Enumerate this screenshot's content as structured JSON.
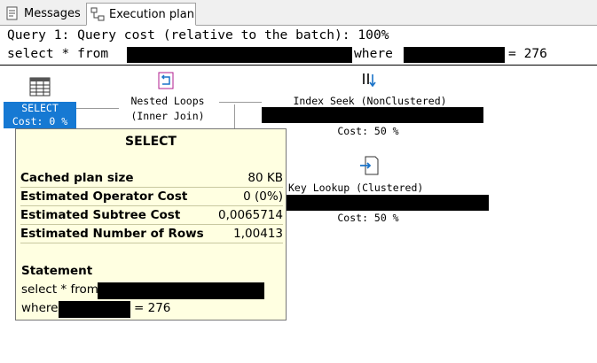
{
  "tabs": {
    "messages": "Messages",
    "plan": "Execution plan"
  },
  "query": {
    "header": "Query 1: Query cost (relative to the batch): 100%",
    "sql_select": "select * from",
    "sql_where": "where",
    "sql_value": "= 276"
  },
  "plan": {
    "select": {
      "name": "SELECT",
      "cost": "Cost: 0 %"
    },
    "nested_loops": {
      "name": "Nested Loops",
      "sub": "(Inner Join)"
    },
    "index_seek": {
      "name": "Index Seek (NonClustered)",
      "cost": "Cost: 50 %"
    },
    "key_lookup": {
      "name": "Key Lookup (Clustered)",
      "cost": "Cost: 50 %"
    }
  },
  "tooltip": {
    "title": "SELECT",
    "rows": [
      {
        "label": "Cached plan size",
        "value": "80 KB"
      },
      {
        "label": "Estimated Operator Cost",
        "value": "0 (0%)"
      },
      {
        "label": "Estimated Subtree Cost",
        "value": "0,0065714"
      },
      {
        "label": "Estimated Number of Rows",
        "value": "1,00413"
      }
    ],
    "statement_label": "Statement",
    "statement_select": "select * from",
    "statement_where": "where",
    "statement_value": "= 276"
  },
  "icons": [
    "messages-icon",
    "execution-plan-icon",
    "select-operator-icon",
    "nested-loops-icon",
    "index-seek-icon",
    "key-lookup-icon"
  ],
  "colors": {
    "selected_node": "#1679d3",
    "tooltip_bg": "#ffffe1",
    "redaction": "#000000"
  }
}
